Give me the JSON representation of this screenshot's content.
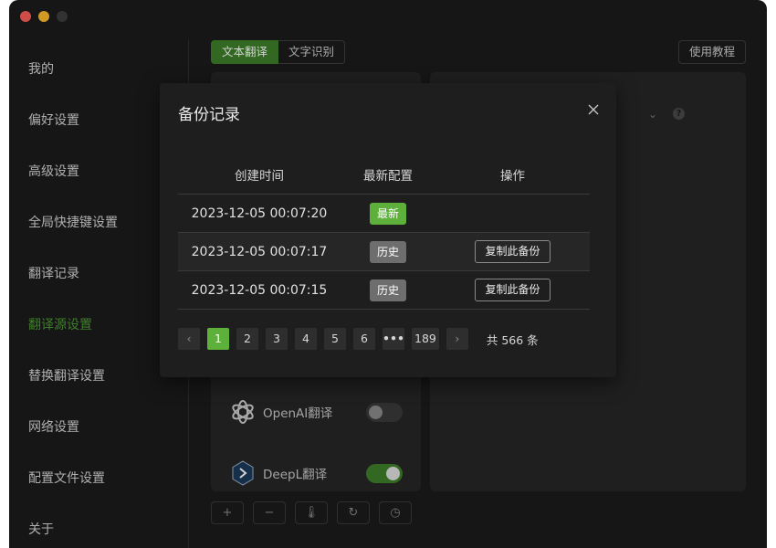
{
  "sidebar": {
    "items": [
      {
        "label": "我的",
        "active": false
      },
      {
        "label": "偏好设置",
        "active": false
      },
      {
        "label": "高级设置",
        "active": false
      },
      {
        "label": "全局快捷键设置",
        "active": false
      },
      {
        "label": "翻译记录",
        "active": false
      },
      {
        "label": "翻译源设置",
        "active": true
      },
      {
        "label": "替换翻译设置",
        "active": false
      },
      {
        "label": "网络设置",
        "active": false
      },
      {
        "label": "配置文件设置",
        "active": false
      },
      {
        "label": "关于",
        "active": false
      }
    ]
  },
  "header": {
    "tabs": [
      {
        "label": "文本翻译",
        "active": true
      },
      {
        "label": "文字识别",
        "active": false
      }
    ],
    "tutorial_label": "使用教程"
  },
  "services": [
    {
      "name": "OpenAI翻译",
      "icon": "openai-icon",
      "enabled": false
    },
    {
      "name": "DeepL翻译",
      "icon": "deepl-icon",
      "enabled": true
    }
  ],
  "toolbar": {
    "buttons": [
      {
        "icon": "plus-icon",
        "glyph": "+"
      },
      {
        "icon": "minus-icon",
        "glyph": "−"
      },
      {
        "icon": "thermometer-icon",
        "glyph": "🌡"
      },
      {
        "icon": "refresh-icon",
        "glyph": "↻"
      },
      {
        "icon": "clock-icon",
        "glyph": "◷"
      }
    ]
  },
  "modal": {
    "title": "备份记录",
    "columns": [
      "创建时间",
      "最新配置",
      "操作"
    ],
    "rows": [
      {
        "time": "2023-12-05 00:07:20",
        "status": "最新",
        "status_type": "latest",
        "action": ""
      },
      {
        "time": "2023-12-05 00:07:17",
        "status": "历史",
        "status_type": "history",
        "action": "复制此备份"
      },
      {
        "time": "2023-12-05 00:07:15",
        "status": "历史",
        "status_type": "history",
        "action": "复制此备份"
      }
    ],
    "pagination": {
      "prev": "‹",
      "next": "›",
      "pages": [
        "1",
        "2",
        "3",
        "4",
        "5",
        "6",
        "•••",
        "189"
      ],
      "current": "1",
      "total_text": "共 566 条"
    }
  },
  "colors": {
    "accent": "#5db13b",
    "sidebar_active": "#4f9a35",
    "background": "#1c1c1c"
  }
}
